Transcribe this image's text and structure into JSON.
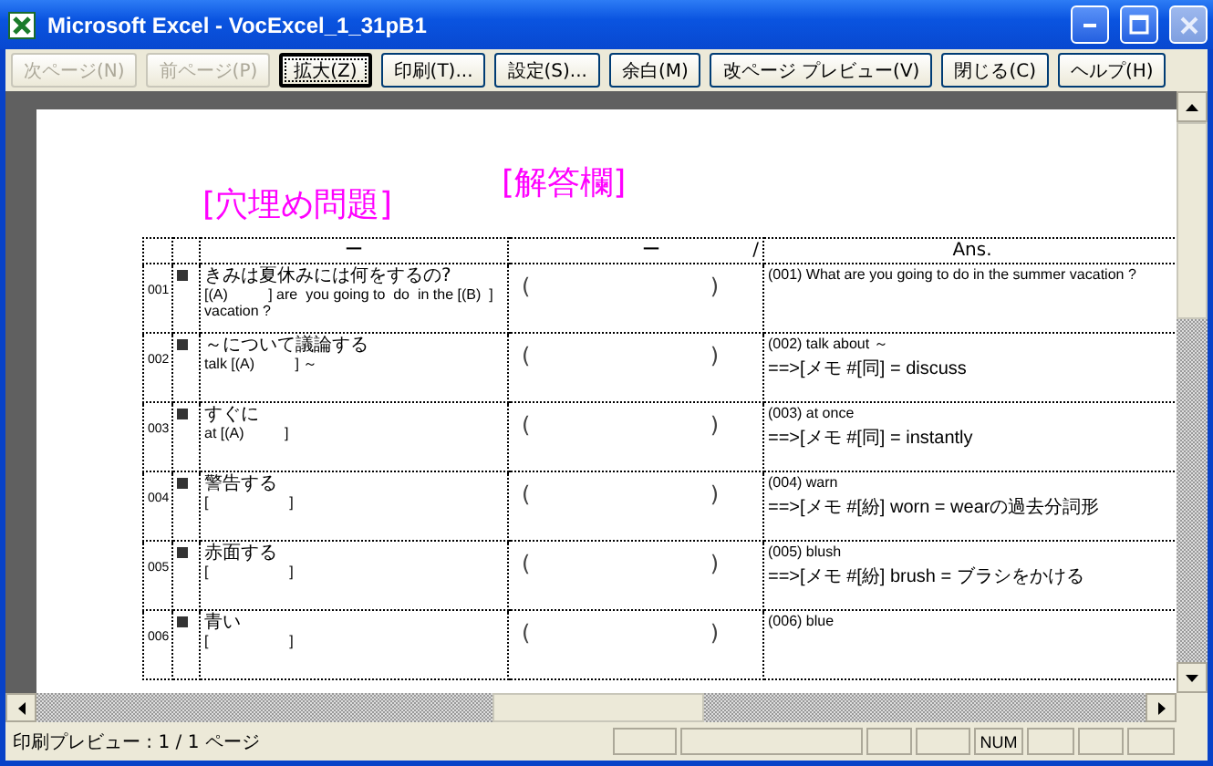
{
  "window": {
    "title": "Microsoft Excel - VocExcel_1_31pB1"
  },
  "toolbar": [
    {
      "label": "次ページ(N)",
      "disabled": true,
      "focused": false
    },
    {
      "label": "前ページ(P)",
      "disabled": true,
      "focused": false
    },
    {
      "label": "拡大(Z)",
      "disabled": false,
      "focused": true
    },
    {
      "label": "印刷(T)...",
      "disabled": false,
      "focused": false
    },
    {
      "label": "設定(S)...",
      "disabled": false,
      "focused": false
    },
    {
      "label": "余白(M)",
      "disabled": false,
      "focused": false
    },
    {
      "label": "改ページ プレビュー(V)",
      "disabled": false,
      "focused": false
    },
    {
      "label": "閉じる(C)",
      "disabled": false,
      "focused": false
    },
    {
      "label": "ヘルプ(H)",
      "disabled": false,
      "focused": false
    }
  ],
  "page": {
    "headings": [
      "[穴埋め問題]",
      "[解答欄]"
    ],
    "table": {
      "columns": [
        "ー",
        "ー",
        "/",
        "Ans."
      ],
      "rows": [
        {
          "number": "001",
          "question_ja": "きみは夏休みには何をするの?",
          "question_en": "[(A)          ] are  you going to  do  in the [(B)  ]  vacation ?",
          "blank_left": "(",
          "blank_right": ")",
          "answer": "(001) What are  you going to  do  in the summer  vacation ?"
        },
        {
          "number": "002",
          "question_ja": "～について議論する",
          "question_en": "talk [(A)          ] ～",
          "blank_left": "(",
          "blank_right": ")",
          "answer": "(002) talk about ～",
          "memo": "==>[メモ  #[同] = discuss"
        },
        {
          "number": "003",
          "question_ja": "すぐに",
          "question_en": "at [(A)          ]",
          "blank_left": "(",
          "blank_right": ")",
          "answer": "(003) at once",
          "memo": "==>[メモ  #[同] = instantly"
        },
        {
          "number": "004",
          "question_ja": "警告する",
          "question_en": "[                    ]",
          "blank_left": "(",
          "blank_right": ")",
          "answer": "(004) warn",
          "memo": "==>[メモ  #[紛] worn = wearの過去分詞形"
        },
        {
          "number": "005",
          "question_ja": "赤面する",
          "question_en": "[                    ]",
          "blank_left": "(",
          "blank_right": ")",
          "answer": "(005) blush",
          "memo": "==>[メモ  #[紛] brush = ブラシをかける"
        },
        {
          "number": "006",
          "question_ja": "青い",
          "question_en": "[                    ]",
          "blank_left": "(",
          "blank_right": ")",
          "answer": "(006) blue"
        }
      ]
    }
  },
  "status_bar": {
    "text": "印刷プレビュー : 1 / 1 ページ",
    "indicator": "NUM"
  }
}
